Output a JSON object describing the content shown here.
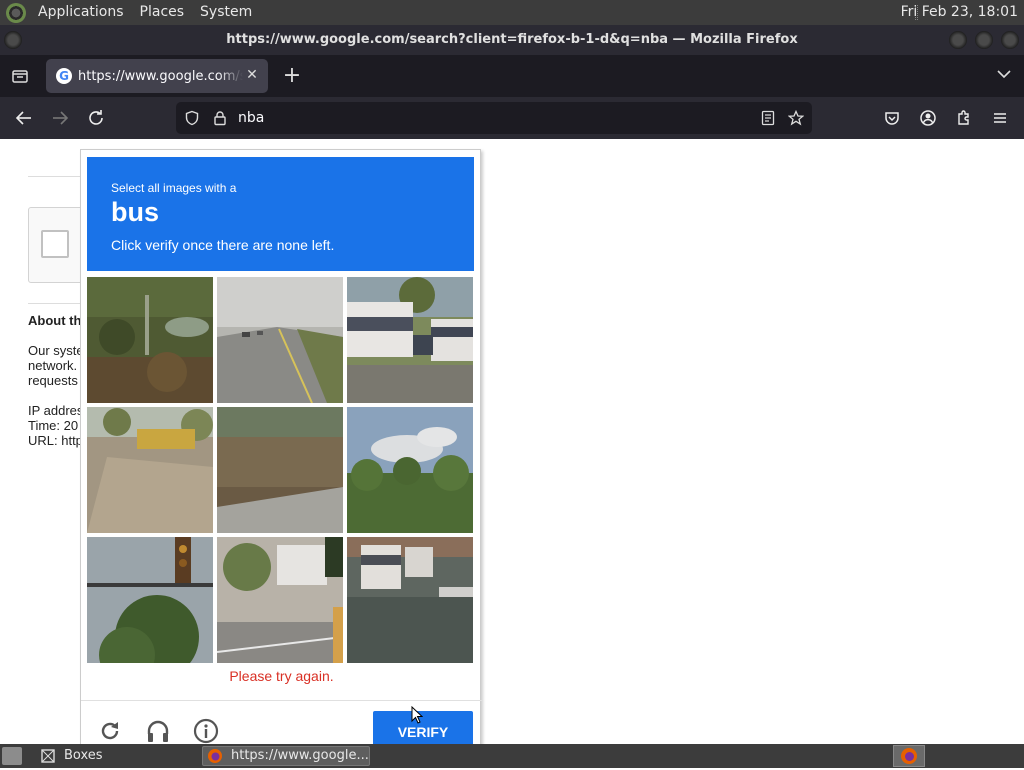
{
  "top_panel": {
    "menus": [
      "Applications",
      "Places",
      "System"
    ],
    "clock": "Fri Feb 23, 18:01"
  },
  "window": {
    "title": "https://www.google.com/search?client=firefox-b-1-d&q=nba — Mozilla Firefox"
  },
  "tabs": [
    {
      "title": "https://www.google.com/search?client=firefox-b-1-d&q=nba",
      "favicon": "G"
    }
  ],
  "urlbar": {
    "value": "nba"
  },
  "page": {
    "about_heading": "About th",
    "about_lines": [
      "Our syste",
      "network.",
      "requests"
    ],
    "info_lines": [
      "IP addres",
      "Time: 20",
      "URL: http"
    ]
  },
  "challenge": {
    "line1": "Select all images with a",
    "object": "bus",
    "line3": "Click verify once there are none left.",
    "retry_message": "Please try again.",
    "verify_label": "VERIFY",
    "accent_color": "#1a73e8",
    "error_color": "#d93025",
    "tiles": [
      "foliage",
      "highway",
      "buses",
      "school-bus",
      "field",
      "sky-trees",
      "traffic-light",
      "street-corner",
      "city-buses"
    ]
  },
  "taskbar": {
    "tasks": [
      {
        "label": "Boxes"
      },
      {
        "label": "https://www.google..."
      }
    ]
  }
}
